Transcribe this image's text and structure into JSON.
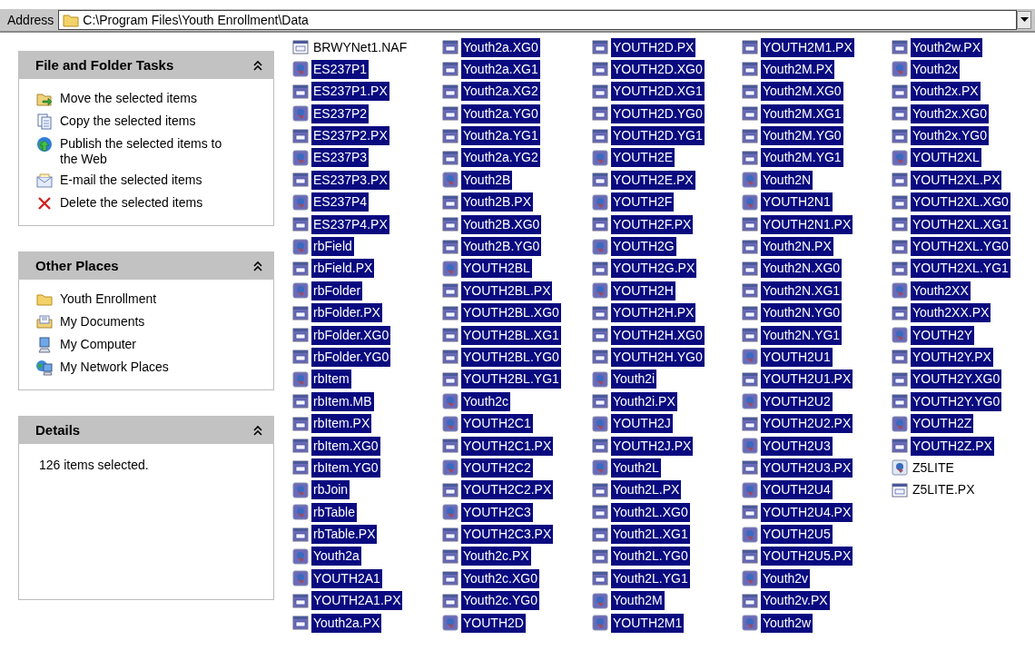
{
  "address_bar": {
    "label": "Address",
    "path": "C:\\Program Files\\Youth Enrollment\\Data"
  },
  "panels": [
    {
      "title": "File and Folder Tasks",
      "expanded": true,
      "items": [
        {
          "label": "Move the selected items",
          "kind": "move"
        },
        {
          "label": "Copy the selected items",
          "kind": "copy"
        },
        {
          "label": "Publish the selected items to the Web",
          "kind": "publish"
        },
        {
          "label": "E-mail the selected items",
          "kind": "email"
        },
        {
          "label": "Delete the selected items",
          "kind": "delete"
        }
      ]
    },
    {
      "title": "Other Places",
      "expanded": true,
      "items": [
        {
          "label": "Youth Enrollment",
          "kind": "folder"
        },
        {
          "label": "My Documents",
          "kind": "documents"
        },
        {
          "label": "My Computer",
          "kind": "computer"
        },
        {
          "label": "My Network Places",
          "kind": "network"
        }
      ]
    },
    {
      "title": "Details",
      "expanded": true,
      "text": "126 items selected."
    }
  ],
  "files": [
    {
      "name": "BRWYNet1.NAF",
      "kind": "doc",
      "selected": false
    },
    {
      "name": "ES237P1",
      "kind": "app",
      "selected": true
    },
    {
      "name": "ES237P1.PX",
      "kind": "doc",
      "selected": true
    },
    {
      "name": "ES237P2",
      "kind": "app",
      "selected": true
    },
    {
      "name": "ES237P2.PX",
      "kind": "doc",
      "selected": true
    },
    {
      "name": "ES237P3",
      "kind": "app",
      "selected": true
    },
    {
      "name": "ES237P3.PX",
      "kind": "doc",
      "selected": true
    },
    {
      "name": "ES237P4",
      "kind": "app",
      "selected": true
    },
    {
      "name": "ES237P4.PX",
      "kind": "doc",
      "selected": true
    },
    {
      "name": "rbField",
      "kind": "app",
      "selected": true
    },
    {
      "name": "rbField.PX",
      "kind": "doc",
      "selected": true
    },
    {
      "name": "rbFolder",
      "kind": "app",
      "selected": true
    },
    {
      "name": "rbFolder.PX",
      "kind": "doc",
      "selected": true
    },
    {
      "name": "rbFolder.XG0",
      "kind": "doc",
      "selected": true
    },
    {
      "name": "rbFolder.YG0",
      "kind": "doc",
      "selected": true
    },
    {
      "name": "rbItem",
      "kind": "app",
      "selected": true
    },
    {
      "name": "rbItem.MB",
      "kind": "doc",
      "selected": true
    },
    {
      "name": "rbItem.PX",
      "kind": "doc",
      "selected": true
    },
    {
      "name": "rbItem.XG0",
      "kind": "doc",
      "selected": true
    },
    {
      "name": "rbItem.YG0",
      "kind": "doc",
      "selected": true
    },
    {
      "name": "rbJoin",
      "kind": "app",
      "selected": true
    },
    {
      "name": "rbTable",
      "kind": "app",
      "selected": true
    },
    {
      "name": "rbTable.PX",
      "kind": "doc",
      "selected": true
    },
    {
      "name": "Youth2a",
      "kind": "app",
      "selected": true
    },
    {
      "name": "YOUTH2A1",
      "kind": "app",
      "selected": true
    },
    {
      "name": "YOUTH2A1.PX",
      "kind": "doc",
      "selected": true
    },
    {
      "name": "Youth2a.PX",
      "kind": "doc",
      "selected": true
    },
    {
      "name": "Youth2a.XG0",
      "kind": "doc",
      "selected": true
    },
    {
      "name": "Youth2a.XG1",
      "kind": "doc",
      "selected": true
    },
    {
      "name": "Youth2a.XG2",
      "kind": "doc",
      "selected": true
    },
    {
      "name": "Youth2a.YG0",
      "kind": "doc",
      "selected": true
    },
    {
      "name": "Youth2a.YG1",
      "kind": "doc",
      "selected": true
    },
    {
      "name": "Youth2a.YG2",
      "kind": "doc",
      "selected": true
    },
    {
      "name": "Youth2B",
      "kind": "app",
      "selected": true
    },
    {
      "name": "Youth2B.PX",
      "kind": "doc",
      "selected": true
    },
    {
      "name": "Youth2B.XG0",
      "kind": "doc",
      "selected": true
    },
    {
      "name": "Youth2B.YG0",
      "kind": "doc",
      "selected": true
    },
    {
      "name": "YOUTH2BL",
      "kind": "app",
      "selected": true
    },
    {
      "name": "YOUTH2BL.PX",
      "kind": "doc",
      "selected": true
    },
    {
      "name": "YOUTH2BL.XG0",
      "kind": "doc",
      "selected": true
    },
    {
      "name": "YOUTH2BL.XG1",
      "kind": "doc",
      "selected": true
    },
    {
      "name": "YOUTH2BL.YG0",
      "kind": "doc",
      "selected": true
    },
    {
      "name": "YOUTH2BL.YG1",
      "kind": "doc",
      "selected": true
    },
    {
      "name": "Youth2c",
      "kind": "app",
      "selected": true
    },
    {
      "name": "YOUTH2C1",
      "kind": "app",
      "selected": true
    },
    {
      "name": "YOUTH2C1.PX",
      "kind": "doc",
      "selected": true
    },
    {
      "name": "YOUTH2C2",
      "kind": "app",
      "selected": true
    },
    {
      "name": "YOUTH2C2.PX",
      "kind": "doc",
      "selected": true
    },
    {
      "name": "YOUTH2C3",
      "kind": "app",
      "selected": true
    },
    {
      "name": "YOUTH2C3.PX",
      "kind": "doc",
      "selected": true
    },
    {
      "name": "Youth2c.PX",
      "kind": "doc",
      "selected": true
    },
    {
      "name": "Youth2c.XG0",
      "kind": "doc",
      "selected": true
    },
    {
      "name": "Youth2c.YG0",
      "kind": "doc",
      "selected": true
    },
    {
      "name": "YOUTH2D",
      "kind": "app",
      "selected": true
    },
    {
      "name": "YOUTH2D.PX",
      "kind": "doc",
      "selected": true
    },
    {
      "name": "YOUTH2D.XG0",
      "kind": "doc",
      "selected": true
    },
    {
      "name": "YOUTH2D.XG1",
      "kind": "doc",
      "selected": true
    },
    {
      "name": "YOUTH2D.YG0",
      "kind": "doc",
      "selected": true
    },
    {
      "name": "YOUTH2D.YG1",
      "kind": "doc",
      "selected": true
    },
    {
      "name": "YOUTH2E",
      "kind": "app",
      "selected": true
    },
    {
      "name": "YOUTH2E.PX",
      "kind": "doc",
      "selected": true
    },
    {
      "name": "YOUTH2F",
      "kind": "app",
      "selected": true
    },
    {
      "name": "YOUTH2F.PX",
      "kind": "doc",
      "selected": true
    },
    {
      "name": "YOUTH2G",
      "kind": "app",
      "selected": true
    },
    {
      "name": "YOUTH2G.PX",
      "kind": "doc",
      "selected": true
    },
    {
      "name": "YOUTH2H",
      "kind": "app",
      "selected": true
    },
    {
      "name": "YOUTH2H.PX",
      "kind": "doc",
      "selected": true
    },
    {
      "name": "YOUTH2H.XG0",
      "kind": "doc",
      "selected": true
    },
    {
      "name": "YOUTH2H.YG0",
      "kind": "doc",
      "selected": true
    },
    {
      "name": "Youth2i",
      "kind": "app",
      "selected": true
    },
    {
      "name": "Youth2i.PX",
      "kind": "doc",
      "selected": true
    },
    {
      "name": "YOUTH2J",
      "kind": "app",
      "selected": true
    },
    {
      "name": "YOUTH2J.PX",
      "kind": "doc",
      "selected": true
    },
    {
      "name": "Youth2L",
      "kind": "app",
      "selected": true
    },
    {
      "name": "Youth2L.PX",
      "kind": "doc",
      "selected": true
    },
    {
      "name": "Youth2L.XG0",
      "kind": "doc",
      "selected": true
    },
    {
      "name": "Youth2L.XG1",
      "kind": "doc",
      "selected": true
    },
    {
      "name": "Youth2L.YG0",
      "kind": "doc",
      "selected": true
    },
    {
      "name": "Youth2L.YG1",
      "kind": "doc",
      "selected": true
    },
    {
      "name": "Youth2M",
      "kind": "app",
      "selected": true
    },
    {
      "name": "YOUTH2M1",
      "kind": "app",
      "selected": true
    },
    {
      "name": "YOUTH2M1.PX",
      "kind": "doc",
      "selected": true
    },
    {
      "name": "Youth2M.PX",
      "kind": "doc",
      "selected": true
    },
    {
      "name": "Youth2M.XG0",
      "kind": "doc",
      "selected": true
    },
    {
      "name": "Youth2M.XG1",
      "kind": "doc",
      "selected": true
    },
    {
      "name": "Youth2M.YG0",
      "kind": "doc",
      "selected": true
    },
    {
      "name": "Youth2M.YG1",
      "kind": "doc",
      "selected": true
    },
    {
      "name": "Youth2N",
      "kind": "app",
      "selected": true
    },
    {
      "name": "YOUTH2N1",
      "kind": "app",
      "selected": true
    },
    {
      "name": "YOUTH2N1.PX",
      "kind": "doc",
      "selected": true
    },
    {
      "name": "Youth2N.PX",
      "kind": "doc",
      "selected": true
    },
    {
      "name": "Youth2N.XG0",
      "kind": "doc",
      "selected": true
    },
    {
      "name": "Youth2N.XG1",
      "kind": "doc",
      "selected": true
    },
    {
      "name": "Youth2N.YG0",
      "kind": "doc",
      "selected": true
    },
    {
      "name": "Youth2N.YG1",
      "kind": "doc",
      "selected": true
    },
    {
      "name": "YOUTH2U1",
      "kind": "app",
      "selected": true
    },
    {
      "name": "YOUTH2U1.PX",
      "kind": "doc",
      "selected": true
    },
    {
      "name": "YOUTH2U2",
      "kind": "app",
      "selected": true
    },
    {
      "name": "YOUTH2U2.PX",
      "kind": "doc",
      "selected": true
    },
    {
      "name": "YOUTH2U3",
      "kind": "app",
      "selected": true
    },
    {
      "name": "YOUTH2U3.PX",
      "kind": "doc",
      "selected": true
    },
    {
      "name": "YOUTH2U4",
      "kind": "app",
      "selected": true
    },
    {
      "name": "YOUTH2U4.PX",
      "kind": "doc",
      "selected": true
    },
    {
      "name": "YOUTH2U5",
      "kind": "app",
      "selected": true
    },
    {
      "name": "YOUTH2U5.PX",
      "kind": "doc",
      "selected": true
    },
    {
      "name": "Youth2v",
      "kind": "app",
      "selected": true
    },
    {
      "name": "Youth2v.PX",
      "kind": "doc",
      "selected": true
    },
    {
      "name": "Youth2w",
      "kind": "app",
      "selected": true
    },
    {
      "name": "Youth2w.PX",
      "kind": "doc",
      "selected": true
    },
    {
      "name": "Youth2x",
      "kind": "app",
      "selected": true
    },
    {
      "name": "Youth2x.PX",
      "kind": "doc",
      "selected": true
    },
    {
      "name": "Youth2x.XG0",
      "kind": "doc",
      "selected": true
    },
    {
      "name": "Youth2x.YG0",
      "kind": "doc",
      "selected": true
    },
    {
      "name": "YOUTH2XL",
      "kind": "app",
      "selected": true
    },
    {
      "name": "YOUTH2XL.PX",
      "kind": "doc",
      "selected": true
    },
    {
      "name": "YOUTH2XL.XG0",
      "kind": "doc",
      "selected": true
    },
    {
      "name": "YOUTH2XL.XG1",
      "kind": "doc",
      "selected": true
    },
    {
      "name": "YOUTH2XL.YG0",
      "kind": "doc",
      "selected": true
    },
    {
      "name": "YOUTH2XL.YG1",
      "kind": "doc",
      "selected": true
    },
    {
      "name": "Youth2XX",
      "kind": "app",
      "selected": true
    },
    {
      "name": "Youth2XX.PX",
      "kind": "doc",
      "selected": true
    },
    {
      "name": "YOUTH2Y",
      "kind": "app",
      "selected": true
    },
    {
      "name": "YOUTH2Y.PX",
      "kind": "doc",
      "selected": true
    },
    {
      "name": "YOUTH2Y.XG0",
      "kind": "doc",
      "selected": true
    },
    {
      "name": "YOUTH2Y.YG0",
      "kind": "doc",
      "selected": true
    },
    {
      "name": "YOUTH2Z",
      "kind": "app",
      "selected": true
    },
    {
      "name": "YOUTH2Z.PX",
      "kind": "doc",
      "selected": true
    },
    {
      "name": "Z5LITE",
      "kind": "app",
      "selected": false
    },
    {
      "name": "Z5LITE.PX",
      "kind": "doc",
      "selected": false
    }
  ]
}
